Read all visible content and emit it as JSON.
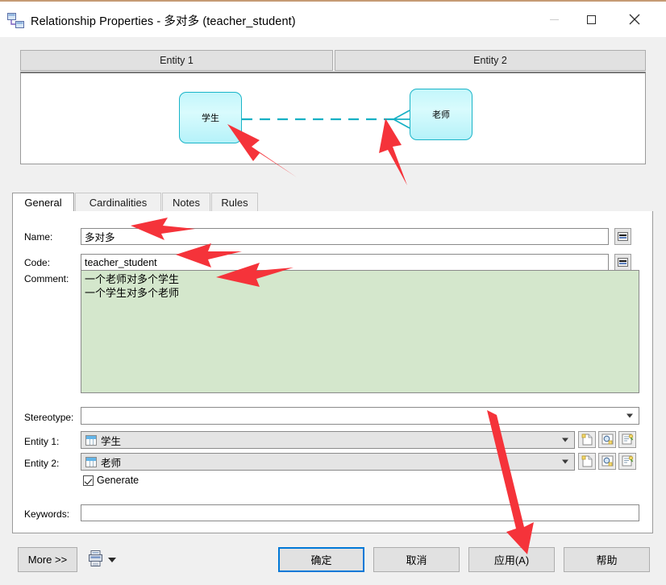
{
  "window": {
    "title": "Relationship Properties - 多对多 (teacher_student)",
    "app_icon": "relationship-icon",
    "controls": {
      "minimize": "minimize-icon",
      "maximize": "maximize-icon",
      "close": "close-icon"
    }
  },
  "diagram": {
    "headers": [
      {
        "label": "Entity 1"
      },
      {
        "label": "Entity 2"
      }
    ],
    "entities": [
      {
        "name": "学生"
      },
      {
        "name": "老师"
      }
    ],
    "connector": {
      "style": "dashed",
      "color": "#16b0c4",
      "end_marker": "crow-foot"
    }
  },
  "tabs": [
    {
      "label": "General",
      "selected": true
    },
    {
      "label": "Cardinalities",
      "selected": false
    },
    {
      "label": "Notes",
      "selected": false
    },
    {
      "label": "Rules",
      "selected": false
    }
  ],
  "form": {
    "name": {
      "label": "Name:",
      "value": "多对多"
    },
    "code": {
      "label": "Code:",
      "value": "teacher_student"
    },
    "comment": {
      "label": "Comment:",
      "value": "一个老师对多个学生\n一个学生对多个老师",
      "background": "#d4e7cc"
    },
    "stereotype": {
      "label": "Stereotype:",
      "value": ""
    },
    "entity1": {
      "label": "Entity 1:",
      "value": "学生",
      "icon": "table-icon"
    },
    "entity2": {
      "label": "Entity 2:",
      "value": "老师",
      "icon": "table-icon"
    },
    "generate": {
      "label": "Generate",
      "checked": true
    },
    "keywords": {
      "label": "Keywords:",
      "value": ""
    },
    "row_buttons": [
      {
        "name": "new-icon"
      },
      {
        "name": "browse-icon"
      },
      {
        "name": "properties-icon"
      }
    ],
    "equals_buttons": [
      {
        "name": "name-equals-button"
      },
      {
        "name": "code-equals-button"
      }
    ]
  },
  "footer": {
    "more": "More >>",
    "print_icon": "print-icon",
    "print_dropdown": "chevron-down-icon",
    "ok": "确定",
    "cancel": "取消",
    "apply": "应用(A)",
    "help": "帮助"
  },
  "colors": {
    "accent": "#0078d7",
    "entity_fill": "#c3f6fb",
    "entity_border": "#1ab4c8",
    "comment_bg": "#d4e7cc",
    "annotation": "#f5333a",
    "top_border": "#c59a74"
  }
}
